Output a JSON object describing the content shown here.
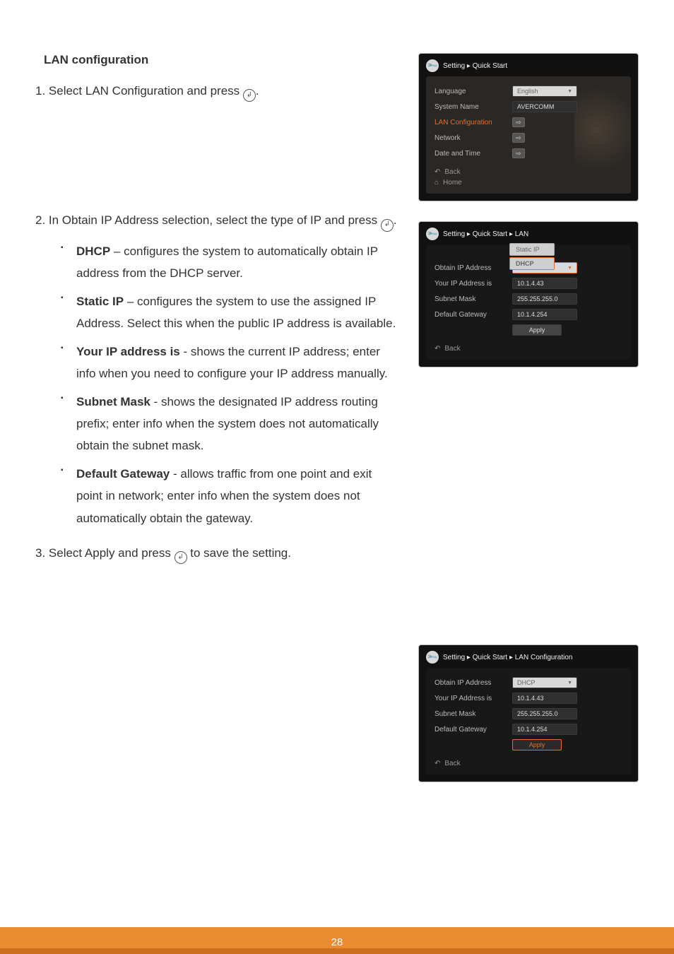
{
  "section_title": "LAN configuration",
  "step1": {
    "prefix": "1. Select LAN Configuration and press ",
    "suffix": "."
  },
  "step2": {
    "prefix": "2. In Obtain IP Address selection, select the type of IP and press ",
    "suffix": "."
  },
  "bullets": {
    "dhcp_label": "DHCP",
    "dhcp_text": " – configures the system to automatically obtain IP address from the DHCP server.",
    "static_label": "Static IP",
    "static_text": " – configures the system to use the assigned IP Address. Select this when the public IP address is available.",
    "yourip_label": "Your IP address is",
    "yourip_text": " - shows the current IP address; enter info when you need to configure your IP address manually.",
    "subnet_label": "Subnet Mask",
    "subnet_text": " - shows the designated IP address routing prefix; enter info when the system does not automatically obtain the subnet mask.",
    "gateway_label": "Default Gateway",
    "gateway_text": " - allows traffic from one point and exit point in network; enter info when the system does not automatically obtain the gateway."
  },
  "step3": {
    "prefix": "3. Select Apply and press ",
    "suffix": " to save the setting."
  },
  "panel1": {
    "crumb": "Setting ▸ Quick Start",
    "rows": {
      "language_l": "Language",
      "language_v": "English",
      "sysname_l": "System Name",
      "sysname_v": "AVERCOMM",
      "lanconf_l": "LAN Configuration",
      "network_l": "Network",
      "datetime_l": "Date and Time"
    },
    "back": "Back",
    "home": "Home"
  },
  "panel2": {
    "crumb": "Setting ▸ Quick Start ▸ LAN",
    "options": {
      "a": "Static IP",
      "b": "DHCP"
    },
    "rows": {
      "obtain_l": "Obtain IP Address",
      "obtain_v": "DHCP",
      "yourip_l": "Your IP Address is",
      "yourip_v": "10.1.4.43",
      "subnet_l": "Subnet Mask",
      "subnet_v": "255.255.255.0",
      "gw_l": "Default Gateway",
      "gw_v": "10.1.4.254",
      "apply": "Apply"
    },
    "back": "Back"
  },
  "panel3": {
    "crumb": "Setting ▸ Quick Start ▸ LAN Configuration",
    "rows": {
      "obtain_l": "Obtain IP Address",
      "obtain_v": "DHCP",
      "yourip_l": "Your IP Address is",
      "yourip_v": "10.1.4.43",
      "subnet_l": "Subnet Mask",
      "subnet_v": "255.255.255.0",
      "gw_l": "Default Gateway",
      "gw_v": "10.1.4.254",
      "apply": "Apply"
    },
    "back": "Back"
  },
  "page_no": "28"
}
